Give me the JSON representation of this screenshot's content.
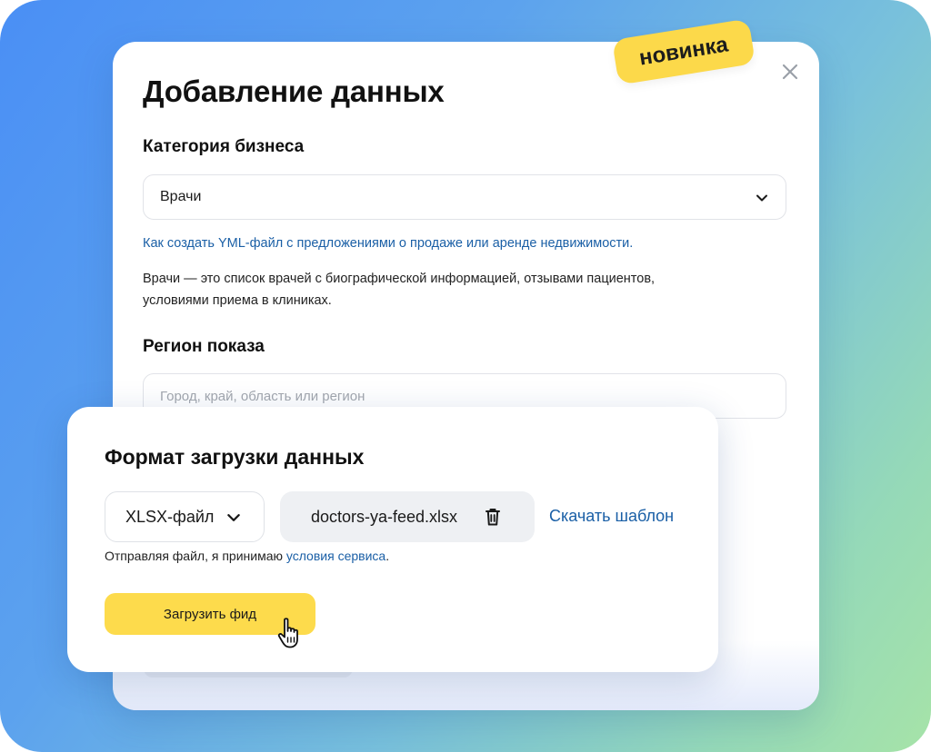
{
  "badge": "новинка",
  "modal": {
    "title": "Добавление данных",
    "business_category_label": "Категория бизнеса",
    "business_category_value": "Врачи",
    "help_link": "Как создать YML-файл с предложениями о продаже или аренде недвижимости.",
    "description": "Врачи — это список врачей с биографической информацией, отзывами пациентов, условиями приема в клиниках.",
    "region_label": "Регион показа",
    "region_placeholder": "Город, край, область или регион"
  },
  "upload_panel": {
    "title": "Формат загрузки данных",
    "file_type": "XLSX-файл",
    "file_name": "doctors-ya-feed.xlsx",
    "template_link": "Скачать шаблон",
    "consent_text": "Отправляя файл, я принимаю ",
    "consent_link": "условия сервиса",
    "consent_end": ".",
    "upload_button": "Загрузить фид"
  },
  "icons": {
    "close": "close-icon",
    "chevron": "chevron-down-icon",
    "trash": "trash-icon",
    "cursor": "hand-pointer-icon"
  },
  "colors": {
    "accent_yellow": "#fddb4c",
    "link_blue": "#1a5fa6",
    "bg_gradient_start": "#4a8ff5",
    "bg_gradient_end": "#a6e3a8"
  }
}
